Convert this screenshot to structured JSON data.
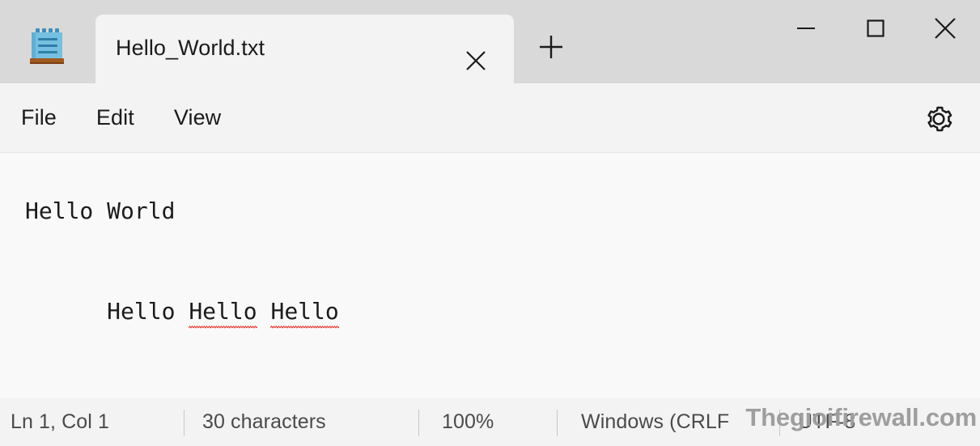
{
  "window": {
    "app_icon": "notepad-icon",
    "tab": {
      "title": "Hello_World.txt",
      "close_icon": "close-icon"
    },
    "new_tab_icon": "plus-icon",
    "controls": {
      "minimize_icon": "minimize-icon",
      "maximize_icon": "maximize-icon",
      "close_icon": "close-icon"
    }
  },
  "menubar": {
    "items": [
      {
        "label": "File"
      },
      {
        "label": "Edit"
      },
      {
        "label": "View"
      }
    ],
    "settings_icon": "gear-icon"
  },
  "editor": {
    "lines": [
      {
        "text": "Hello World"
      }
    ],
    "line2": {
      "word1": "Hello ",
      "word2": "Hello",
      "space": " ",
      "word3": "Hello"
    }
  },
  "statusbar": {
    "cursor_position": "Ln 1, Col 1",
    "character_count": "30 characters",
    "zoom_level": "100%",
    "line_ending": "Windows (CRLF",
    "encoding": "UTF-8"
  },
  "watermark": {
    "text": "Thegioifirewall.com"
  },
  "colors": {
    "titlebar": "#d9d9d9",
    "tab_active": "#f3f3f3",
    "menubar": "#f3f3f3",
    "editor": "#f9f9f9",
    "statusbar": "#f3f3f3",
    "text": "#1b1b1b",
    "status_text": "#4a4a4a",
    "spellcheck_underline": "#e03a2f",
    "watermark": "#9e9e9e"
  }
}
